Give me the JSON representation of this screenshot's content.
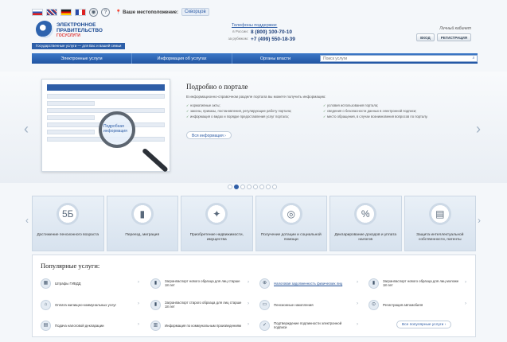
{
  "topbar": {
    "location_label": "Ваше местоположение:",
    "location_city": "Скворцов"
  },
  "header": {
    "logo_line1": "ЭЛЕКТРОННОЕ",
    "logo_line2": "ПРАВИТЕЛЬСТВО",
    "logo_line3": "ГОСУСЛУГИ",
    "slogan": "Государственные услуги — для Вас и вашей семьи",
    "phones_title": "Телефоны поддержки:",
    "phone1_label": "в России:",
    "phone1": "8 (800) 100-70-10",
    "phone2_label": "за рубежом:",
    "phone2": "+7 (499) 550-18-39",
    "auth_title": "Личный кабинет",
    "login": "ВХОД",
    "register": "РЕГИСТРАЦИЯ"
  },
  "nav": {
    "items": [
      "Электронные услуги",
      "Информация об услугах",
      "Органы власти"
    ],
    "search_placeholder": "Поиск услуги"
  },
  "banner": {
    "title": "Подробно о портале",
    "intro": "В информационно-справочном разделе портала вы можете получить информацию:",
    "features": [
      "нормативные акты;",
      "условия использования портала;",
      "законы, приказы, постановления, регулирующие работу портала;",
      "сведения о безопасности данных в электронной подписи;",
      "информация о видах и порядке предоставления услуг портала;",
      "место обращения, в случае возникновения вопросов по порталу."
    ],
    "more": "Вся информация",
    "lens_text": "Подробная информация"
  },
  "categories": [
    {
      "icon": "5Б",
      "label": "Достижение пенсионного возраста"
    },
    {
      "icon": "▮",
      "label": "Переезд, миграция"
    },
    {
      "icon": "✦",
      "label": "Приобретение недвижимости, имущества"
    },
    {
      "icon": "◎",
      "label": "Получение дотации и социальной помощи"
    },
    {
      "icon": "%",
      "label": "Декларирование доходов и уплата налогов"
    },
    {
      "icon": "▤",
      "label": "Защита интеллектуальной собственности, патенты"
    }
  ],
  "popular": {
    "title": "Популярные услуги:",
    "services": [
      {
        "icon": "▦",
        "label": "Штрафы ГИБДД"
      },
      {
        "icon": "▮",
        "label": "Загранпаспорт нового образца для лиц старше 18 лет"
      },
      {
        "icon": "⊕",
        "label": "Налоговая задолженность физических лиц"
      },
      {
        "icon": "▮",
        "label": "Загранпаспорт нового образца для лиц моложе 18 лет"
      },
      {
        "icon": "⌂",
        "label": "Оплата жилищно-коммунальных услуг"
      },
      {
        "icon": "▮",
        "label": "Загранпаспорт старого образца для лиц старше 18 лет"
      },
      {
        "icon": "▭",
        "label": "Пенсионные накопления"
      },
      {
        "icon": "⊙",
        "label": "Регистрация автомобиля"
      },
      {
        "icon": "▤",
        "label": "Подача налоговой декларации"
      },
      {
        "icon": "▥",
        "label": "Информация по коммунальным произведениям"
      },
      {
        "icon": "✓",
        "label": "Подтверждение подлинности электронной подписи"
      }
    ],
    "all_label": "Все популярные услуги"
  }
}
